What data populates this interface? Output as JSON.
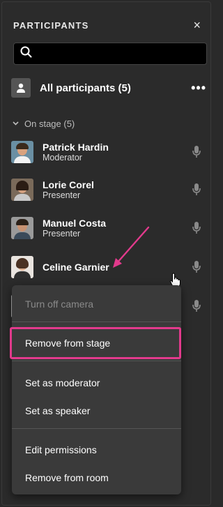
{
  "header": {
    "title": "PARTICIPANTS",
    "close_icon": "×"
  },
  "search": {
    "placeholder": ""
  },
  "all_participants": {
    "label": "All participants (5)",
    "more_icon": "•••"
  },
  "section": {
    "label": "On stage (5)"
  },
  "participants": [
    {
      "name": "Patrick Hardin",
      "role": "Moderator"
    },
    {
      "name": "Lorie Corel",
      "role": "Presenter"
    },
    {
      "name": "Manuel Costa",
      "role": "Presenter"
    },
    {
      "name": "Celine Garnier",
      "role": ""
    }
  ],
  "context_menu": {
    "items": [
      {
        "label": "Turn off camera",
        "disabled": true
      },
      {
        "label": "Remove from stage",
        "disabled": false,
        "highlighted": true
      },
      {
        "label": "Set as moderator",
        "disabled": false
      },
      {
        "label": "Set as speaker",
        "disabled": false
      },
      {
        "label": "Edit permissions",
        "disabled": false
      },
      {
        "label": "Remove from room",
        "disabled": false
      }
    ]
  },
  "colors": {
    "background": "#2b2b2b",
    "menu_background": "#3a3a3a",
    "highlight_border": "#e23a8c",
    "annotation_arrow": "#e23a8c"
  }
}
